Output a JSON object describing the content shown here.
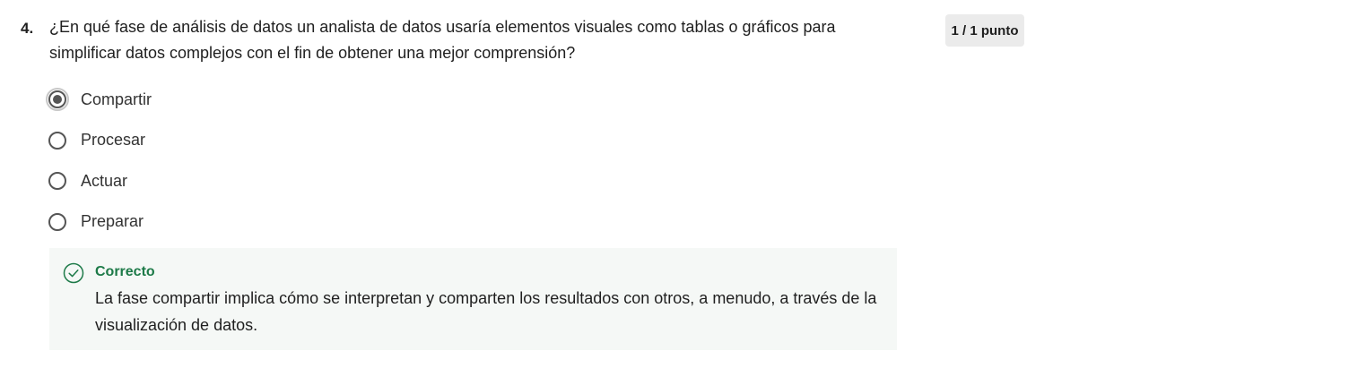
{
  "question": {
    "number": "4.",
    "text": "¿En qué fase de análisis de datos un analista de datos usaría elementos visuales como tablas o gráficos para simplificar datos complejos con el fin de obtener una mejor comprensión?",
    "points": "1 / 1 punto"
  },
  "options": [
    {
      "label": "Compartir",
      "selected": true
    },
    {
      "label": "Procesar",
      "selected": false
    },
    {
      "label": "Actuar",
      "selected": false
    },
    {
      "label": "Preparar",
      "selected": false
    }
  ],
  "feedback": {
    "status": "Correcto",
    "icon": "check-circle-icon",
    "text": "La fase compartir implica cómo se interpretan y comparten los resultados con otros, a menudo, a través de la visualización de datos.",
    "color": "#1d7a48"
  }
}
